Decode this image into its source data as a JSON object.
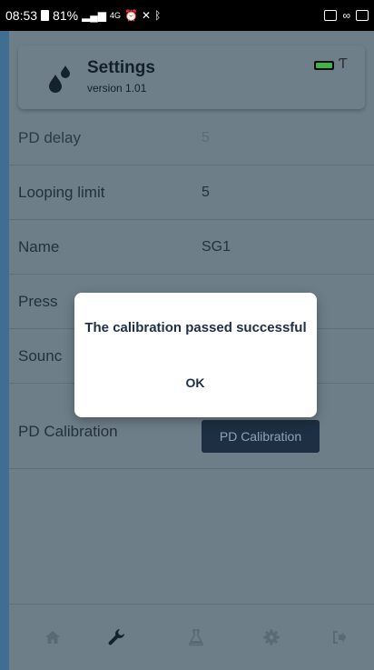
{
  "status_bar": {
    "time": "08:53",
    "battery_text": "81%",
    "signal_text": "4G"
  },
  "header": {
    "title": "Settings",
    "version": "version 1.01"
  },
  "settings": {
    "rows": [
      {
        "label": "PD delay",
        "value": "5"
      },
      {
        "label": "Looping limit",
        "value": "5"
      },
      {
        "label": "Name",
        "value": "SG1"
      },
      {
        "label": "Press",
        "value": ""
      },
      {
        "label": "Sounc",
        "value": ""
      }
    ],
    "calibration": {
      "label": "PD Calibration",
      "button_label": "PD Calibration"
    }
  },
  "dialog": {
    "message": "The calibration passed successful",
    "ok_label": "OK"
  },
  "nav": {
    "items": [
      "home-icon",
      "wrench-icon",
      "flask-icon",
      "gear-icon",
      "logout-icon"
    ]
  },
  "colors": {
    "accent_button": "#1d2f42",
    "battery_fill": "#3fb24a",
    "dialog_text": "#1f2f48"
  }
}
